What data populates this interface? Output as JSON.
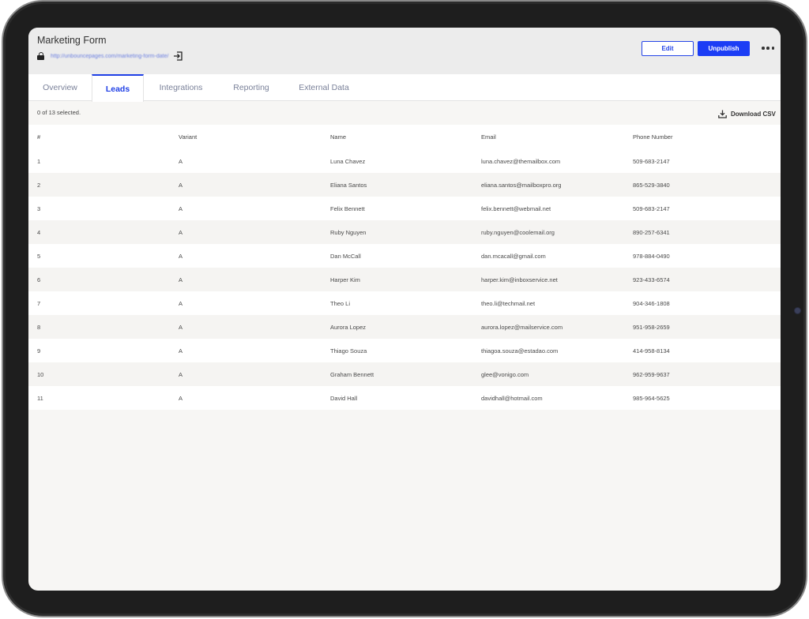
{
  "header": {
    "title": "Marketing Form",
    "url": "http://unbouncepages.com/marketing-form-date/",
    "edit_label": "Edit",
    "unpublish_label": "Unpublish"
  },
  "tabs": [
    {
      "label": "Overview"
    },
    {
      "label": "Leads"
    },
    {
      "label": "Integrations"
    },
    {
      "label": "Reporting"
    },
    {
      "label": "External Data"
    }
  ],
  "active_tab": "Leads",
  "toolbar": {
    "selection_status": "0 of 13 selected.",
    "download_label": "Download CSV"
  },
  "table": {
    "columns": [
      "#",
      "Variant",
      "Name",
      "Email",
      "Phone Number"
    ],
    "rows": [
      [
        "1",
        "A",
        "Luna Chavez",
        "luna.chavez@themailbox.com",
        "509-683-2147"
      ],
      [
        "2",
        "A",
        "Eliana Santos",
        "eliana.santos@mailboxpro.org",
        "865-529-3840"
      ],
      [
        "3",
        "A",
        "Felix Bennett",
        "felix.bennett@webmail.net",
        "509-683-2147"
      ],
      [
        "4",
        "A",
        "Ruby Nguyen",
        "ruby.nguyen@coolemail.org",
        "890-257-6341"
      ],
      [
        "5",
        "A",
        "Dan McCall",
        "dan.mcacall@gmail.com",
        "978-884-0490"
      ],
      [
        "6",
        "A",
        "Harper Kim",
        "harper.kim@inboxservice.net",
        "923-433-6574"
      ],
      [
        "7",
        "A",
        "Theo Li",
        "theo.li@techmail.net",
        "904-346-1808"
      ],
      [
        "8",
        "A",
        "Aurora Lopez",
        "aurora.lopez@mailservice.com",
        "951-958-2659"
      ],
      [
        "9",
        "A",
        "Thiago Souza",
        "thiagoa.souza@estadao.com",
        "414-958-8134"
      ],
      [
        "10",
        "A",
        "Graham Bennett",
        "glee@vonigo.com",
        "962-959-9637"
      ],
      [
        "11",
        "A",
        "David Hall",
        "davidhall@hotmail.com",
        "985-964-5625"
      ]
    ]
  },
  "colors": {
    "accent": "#1f3fe6",
    "unpublish_bg": "#1c3df5",
    "header_bg": "#ececec",
    "bezel": "#1e1e1e"
  },
  "icons": {
    "lock": "lock-icon",
    "open_link": "open-link-icon",
    "more": "more-options-icon",
    "download": "download-icon"
  }
}
